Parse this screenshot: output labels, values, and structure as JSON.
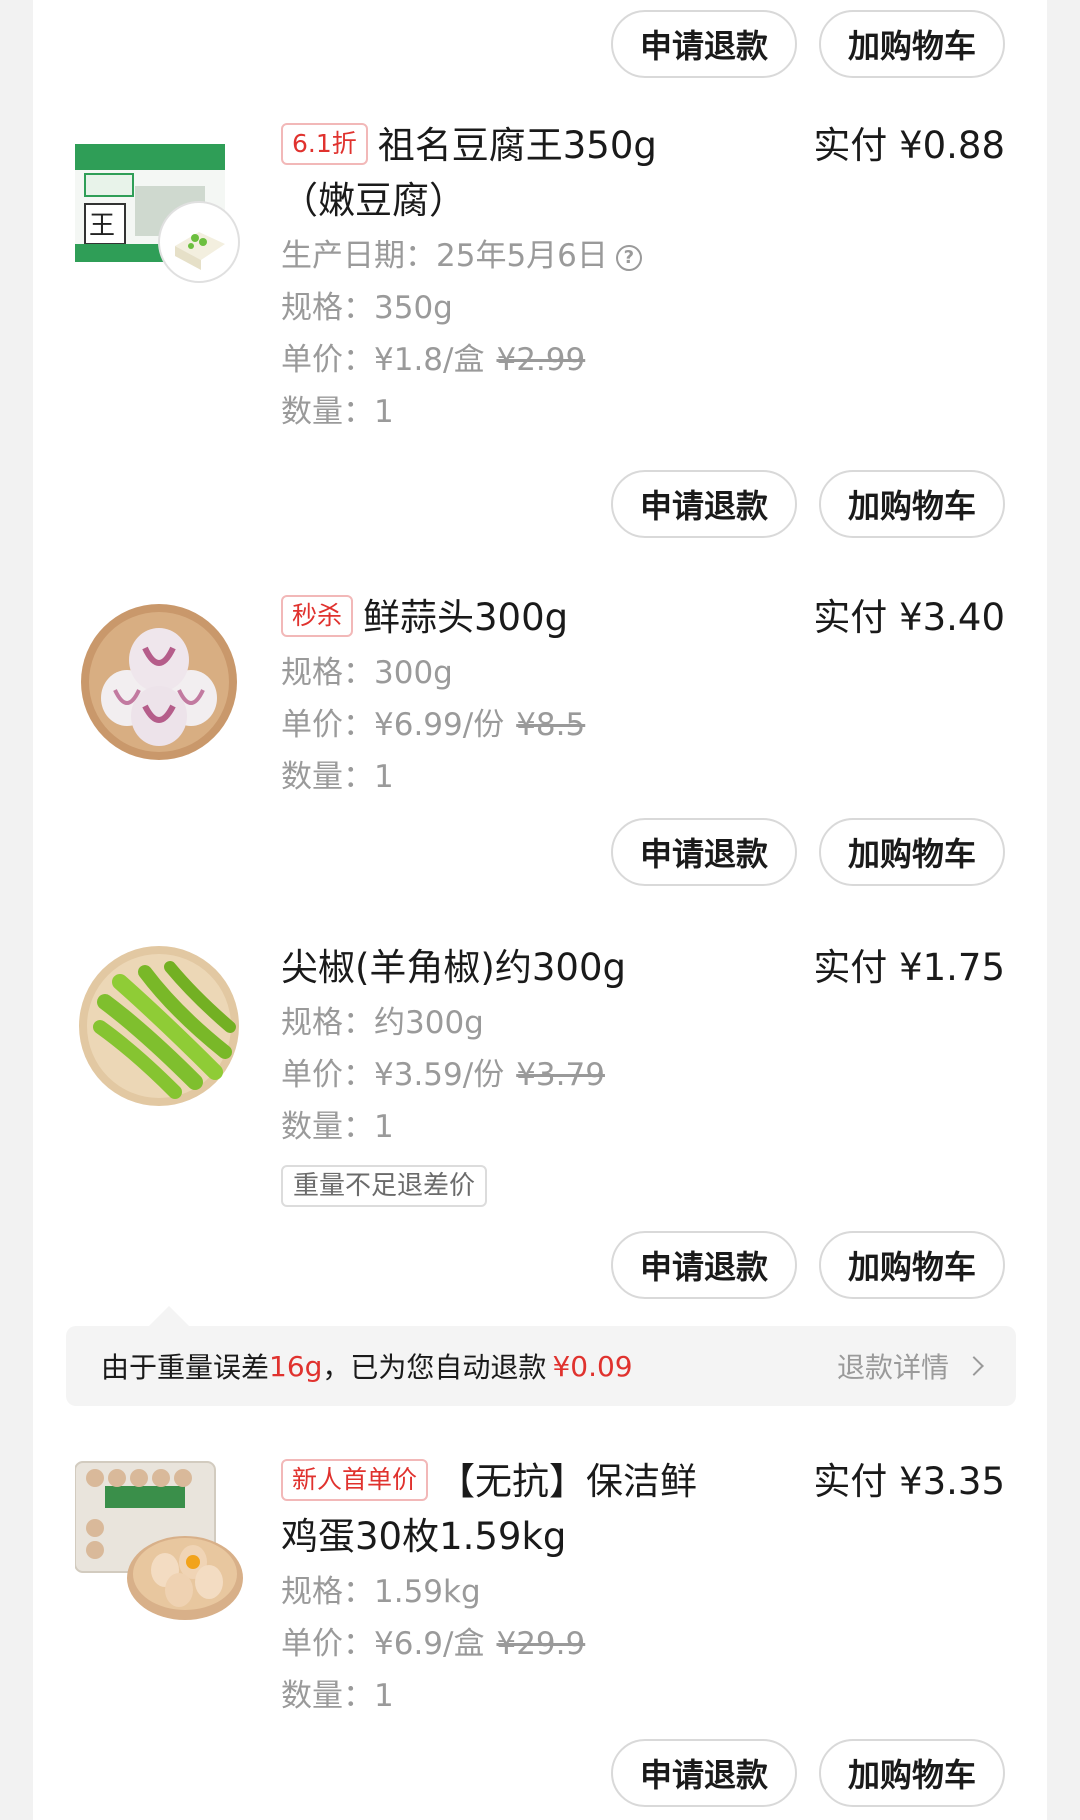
{
  "buttons": {
    "refund": "申请退款",
    "add_cart": "加购物车"
  },
  "items": [
    {
      "tag": "6.1折",
      "title": "祖名豆腐王350g（嫩豆腐）",
      "price": "实付 ¥0.88",
      "production_date": "生产日期：25年5月6日",
      "spec": "规格：350g",
      "unit_price": "单价：¥1.8/盒",
      "original_price": "¥2.99",
      "quantity": "数量：1",
      "image_icon": "tofu-package-image"
    },
    {
      "tag": "秒杀",
      "title": "鲜蒜头300g",
      "price": "实付 ¥3.40",
      "spec": "规格：300g",
      "unit_price": "单价：¥6.99/份",
      "original_price": "¥8.5",
      "quantity": "数量：1",
      "image_icon": "garlic-image"
    },
    {
      "title": "尖椒(羊角椒)约300g",
      "price": "实付 ¥1.75",
      "spec": "规格：约300g",
      "unit_price": "单价：¥3.59/份",
      "original_price": "¥3.79",
      "quantity": "数量：1",
      "note_tag": "重量不足退差价",
      "image_icon": "green-pepper-image"
    },
    {
      "tag": "新人首单价",
      "title": "【无抗】保洁鲜鸡蛋30枚1.59kg",
      "price": "实付 ¥3.35",
      "spec": "规格：1.59kg",
      "unit_price": "单价：¥6.9/盒",
      "original_price": "¥29.9",
      "quantity": "数量：1",
      "image_icon": "eggs-image"
    }
  ],
  "notice": {
    "prefix": "由于重量误差",
    "weight": "16g",
    "middle": "，已为您自动退款",
    "amount": "¥0.09",
    "detail": "退款详情"
  },
  "colors": {
    "accent": "#e0322e",
    "muted": "#9a9a9a",
    "background": "#f2f2f2"
  }
}
